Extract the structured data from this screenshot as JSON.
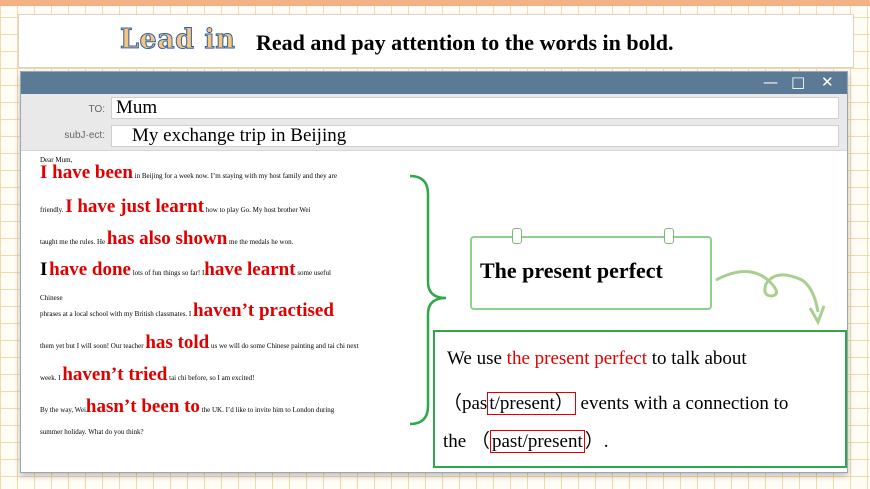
{
  "header": {
    "lead_in": "Lead in",
    "instruction": "Read and pay attention to the  words in bold."
  },
  "email": {
    "window_buttons": {
      "minimize": "—",
      "maximize": "□",
      "close": "✕"
    },
    "to_label": "TO:",
    "to_value": "Mum",
    "subject_label": "subJ·ect:",
    "subject_value": "My exchange trip in Beijing",
    "greeting": "Dear Mum,",
    "segments": {
      "s1_bold": "I have been",
      "s1_small": "in Beijing for a week now.  I’m staying with my host family and they are",
      "s2_small_pre": "friendly.",
      "s2_bold": "I have just learnt",
      "s2_small": "how to play Go.  My host brother Wei",
      "s3_small_pre": "taught me the rules.  He",
      "s3_bold": "has also shown",
      "s3_small": "me the medals he won.",
      "s4_bold_black": "I",
      "s4_bold": "have done",
      "s4_small": "lots of fun things so far! I",
      "s4_bold2": "have learnt",
      "s4_small2": "some useful",
      "s5_small": "Chinese",
      "s6_small_pre": "phrases at a local school with my British classmates.  I",
      "s6_bold": "haven’t practised",
      "s7_small_pre": "them yet but I will soon!  Our teacher",
      "s7_bold": "has told",
      "s7_small": "us we will do some Chinese painting and tai chi next",
      "s8_small_pre": "week.  I",
      "s8_bold": "haven’t tried",
      "s8_small": "tai chi before,  so I am excited!",
      "s9_small_pre": "By the way,  Wei",
      "s9_bold": "hasn’t been to",
      "s9_small": "the UK.  I’d like to invite him to London during",
      "s10_small": "summer holiday.  What do you think?"
    }
  },
  "grammar_box": {
    "title": "The present perfect"
  },
  "rule_box": {
    "line1_pre": "We use ",
    "line1_red": "the present perfect",
    "line1_post": " to talk about",
    "line2_open": "（pas",
    "line2_framed": "t/present）",
    "line2_post": " events with a connection to",
    "line3_pre": "the （",
    "line3_framed": "past/present",
    "line3_post": "）."
  },
  "colors": {
    "accent_red": "#e00000",
    "title_bar": "#5a7a96",
    "green_border": "#2ea84a",
    "light_green_border": "#8fd08f",
    "grid_orange": "#f6d9a8",
    "lead_in_fill": "#f7c67a",
    "lead_in_stroke": "#2e5fa8"
  }
}
